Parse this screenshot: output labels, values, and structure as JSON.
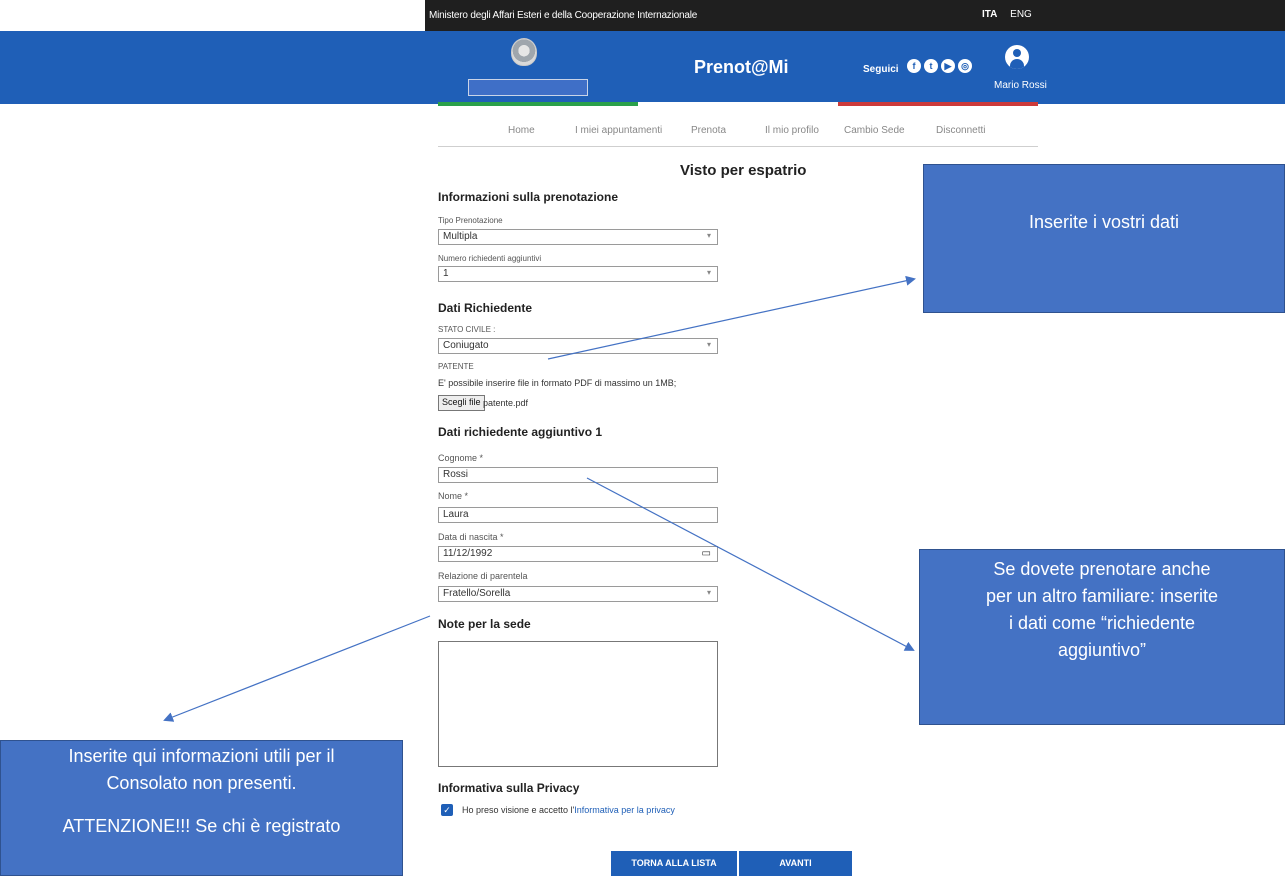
{
  "topbar": {
    "ministry": "Ministero degli Affari Esteri e della Cooperazione Internazionale",
    "lang_ita": "ITA",
    "lang_eng": "ENG"
  },
  "header": {
    "brand": "Prenot@Mi",
    "follow_label": "Seguici",
    "social_icons": [
      "facebook-icon",
      "twitter-icon",
      "youtube-icon",
      "instagram-icon"
    ],
    "username": "Mario Rossi",
    "color": "#1f5fb7"
  },
  "nav": {
    "items": [
      "Home",
      "I miei appuntamenti",
      "Prenota",
      "Il mio profilo",
      "Cambio Sede",
      "Disconnetti"
    ]
  },
  "page": {
    "title": "Visto per espatrio"
  },
  "booking_info": {
    "heading": "Informazioni sulla prenotazione",
    "type_label": "Tipo Prenotazione",
    "type_value": "Multipla",
    "count_label": "Numero richiedenti aggiuntivi",
    "count_value": "1"
  },
  "applicant": {
    "heading": "Dati Richiedente",
    "civil_label": "STATO CIVILE :",
    "civil_value": "Coniugato",
    "license_label": "PATENTE",
    "file_hint": "E' possibile inserire file in formato PDF di massimo un 1MB;",
    "file_button": "Scegli file",
    "file_name": "patente.pdf"
  },
  "additional": {
    "heading": "Dati richiedente aggiuntivo 1",
    "surname_label": "Cognome *",
    "surname_value": "Rossi",
    "name_label": "Nome *",
    "name_value": "Laura",
    "birth_label": "Data di nascita *",
    "birth_value": "11/12/1992",
    "relation_label": "Relazione di parentela",
    "relation_value": "Fratello/Sorella"
  },
  "notes": {
    "heading": "Note per la sede"
  },
  "privacy": {
    "heading": "Informativa sulla Privacy",
    "text": "Ho preso visione e accetto l'",
    "link": "Informativa per la privacy"
  },
  "buttons": {
    "back": "TORNA ALLA LISTA",
    "next": "AVANTI"
  },
  "callouts": {
    "top": "Inserite i vostri dati",
    "middle_lines": [
      "Se dovete prenotare anche",
      "per un altro familiare: inserite",
      "i dati come “richiedente",
      "aggiuntivo”"
    ],
    "bottom_lines": [
      "Inserite qui informazioni utili per il",
      "Consolato non presenti.",
      "",
      "ATTENZIONE!!! Se chi è registrato"
    ],
    "color": "#4472c4"
  }
}
